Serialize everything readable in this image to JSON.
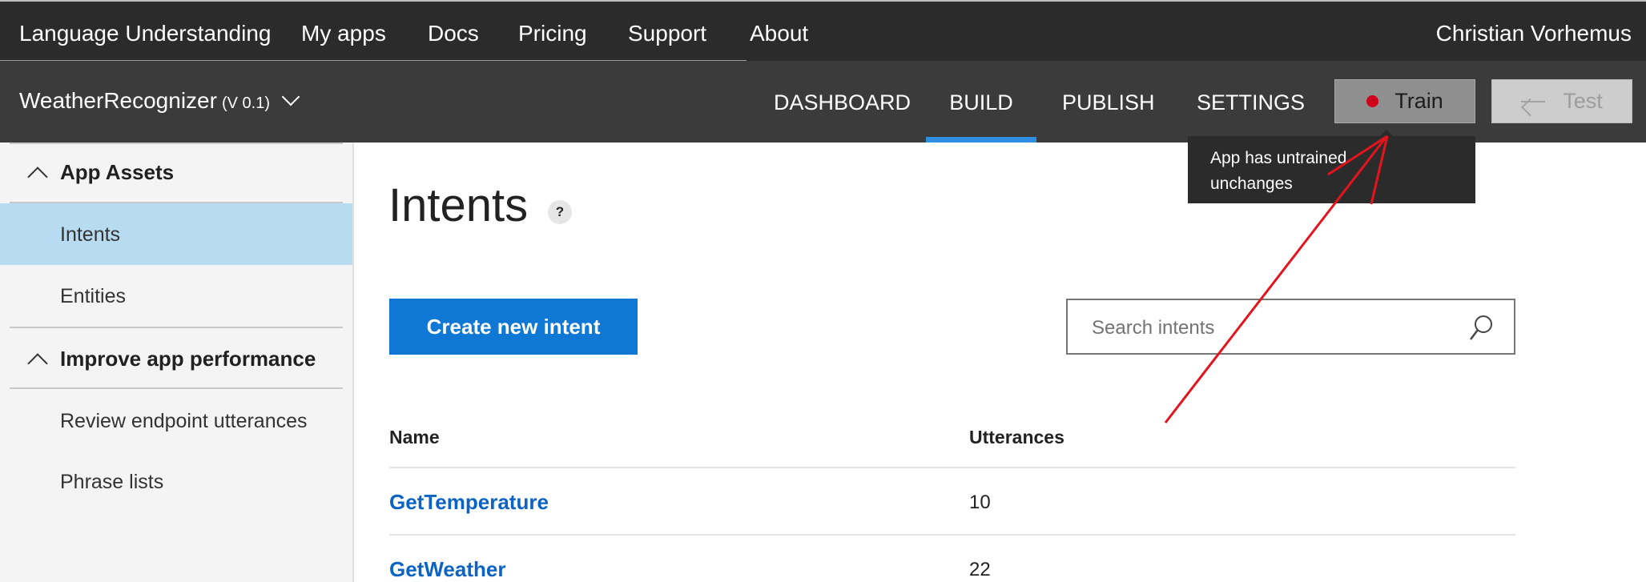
{
  "topnav": {
    "brand": "Language Understanding",
    "items": [
      "My apps",
      "Docs",
      "Pricing",
      "Support",
      "About"
    ],
    "user": "Christian Vorhemus"
  },
  "appbar": {
    "app_name": "WeatherRecognizer",
    "version": "(V 0.1)",
    "tabs": [
      "DASHBOARD",
      "BUILD",
      "PUBLISH",
      "SETTINGS"
    ],
    "active_tab": "BUILD",
    "train_label": "Train",
    "test_label": "Test",
    "train_status_color": "#d0021b",
    "accent_color": "#2e8ee0"
  },
  "tooltip": {
    "line1": "App has untrained",
    "line2": "unchanges"
  },
  "sidebar": {
    "section1": "App Assets",
    "items1": [
      "Intents",
      "Entities"
    ],
    "active_item": "Intents",
    "section2": "Improve app performance",
    "items2": [
      "Review endpoint utterances",
      "Phrase lists"
    ]
  },
  "main": {
    "title": "Intents",
    "help_glyph": "?",
    "create_button": "Create new intent",
    "search_placeholder": "Search intents",
    "table": {
      "columns": [
        "Name",
        "Utterances"
      ],
      "rows": [
        {
          "name": "GetTemperature",
          "utterances": "10"
        },
        {
          "name": "GetWeather",
          "utterances": "22"
        }
      ]
    }
  }
}
